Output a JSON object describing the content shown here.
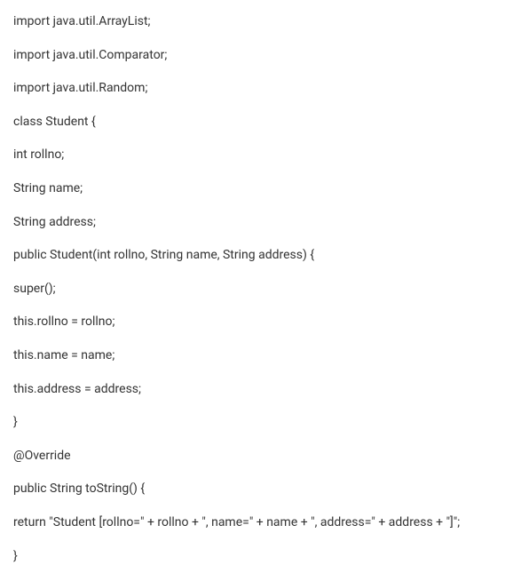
{
  "code": {
    "lines": [
      "import java.util.ArrayList;",
      "import java.util.Comparator;",
      "import java.util.Random;",
      "class Student {",
      "int rollno;",
      "String name;",
      "String address;",
      "public Student(int rollno, String name, String address) {",
      "super();",
      "this.rollno = rollno;",
      "this.name = name;",
      "this.address = address;",
      "}",
      "@Override",
      "public String toString() {",
      "return \"Student [rollno=\" + rollno + \", name=\" + name + \", address=\" + address + \"]\";",
      "}"
    ]
  }
}
